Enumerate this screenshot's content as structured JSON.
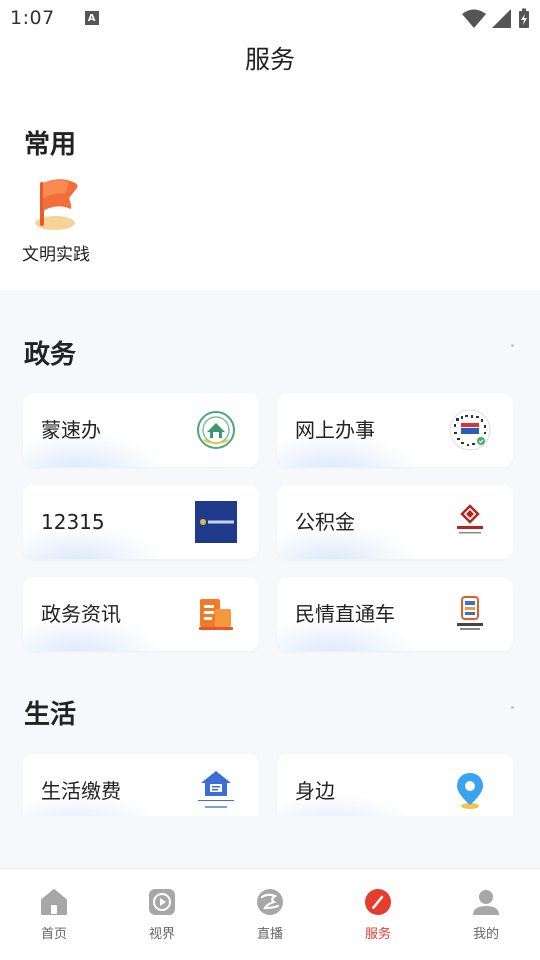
{
  "status_bar": {
    "time": "1:07",
    "notification_letter": "A"
  },
  "header": {
    "title": "服务"
  },
  "common": {
    "title": "常用",
    "items": [
      {
        "label": "文明实践",
        "icon": "flag-icon"
      }
    ]
  },
  "government": {
    "title": "政务",
    "items": [
      {
        "label": "蒙速办",
        "icon": "mengsuban-emblem-icon"
      },
      {
        "label": "网上办事",
        "icon": "qr-code-icon"
      },
      {
        "label": "12315",
        "icon": "consumer-complaint-banner-icon"
      },
      {
        "label": "公积金",
        "icon": "housing-fund-logo-icon"
      },
      {
        "label": "政务资讯",
        "icon": "news-document-icon"
      },
      {
        "label": "民情直通车",
        "icon": "direct-train-icon"
      }
    ]
  },
  "life": {
    "title": "生活",
    "items": [
      {
        "label": "生活缴费",
        "icon": "house-bill-icon"
      },
      {
        "label": "身边",
        "icon": "location-pin-icon"
      }
    ]
  },
  "bottom_nav": {
    "items": [
      {
        "label": "首页",
        "icon": "home-icon",
        "active": false
      },
      {
        "label": "视界",
        "icon": "video-play-icon",
        "active": false
      },
      {
        "label": "直播",
        "icon": "live-logo-icon",
        "active": false
      },
      {
        "label": "服务",
        "icon": "service-pen-icon",
        "active": true
      },
      {
        "label": "我的",
        "icon": "profile-icon",
        "active": false
      }
    ]
  },
  "colors": {
    "accent": "#e43d2f",
    "section_background": "#f6f8fc",
    "icon_gray": "#9a9a9a"
  }
}
